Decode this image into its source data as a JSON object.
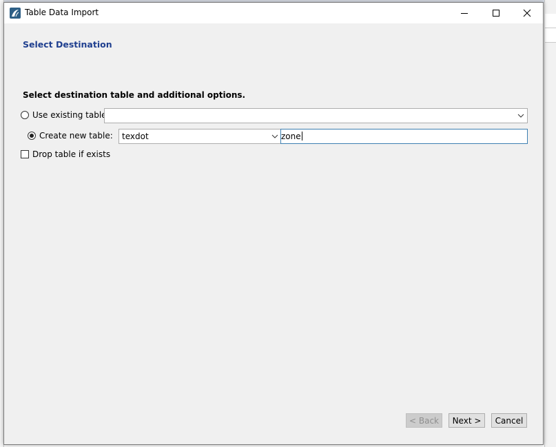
{
  "window": {
    "title": "Table Data Import",
    "minimize_icon": "minimize-icon",
    "maximize_icon": "maximize-icon",
    "close_icon": "close-icon"
  },
  "page": {
    "section_title": "Select Destination",
    "instruction": "Select destination table and additional options."
  },
  "options": {
    "use_existing_label": "Use existing table:",
    "use_existing_value": "",
    "use_existing_selected": false,
    "create_new_label": "Create new table:",
    "create_new_selected": true,
    "schema_value": "texdot",
    "table_name_value": "zone",
    "drop_table_label": "Drop table if exists",
    "drop_table_checked": false
  },
  "buttons": {
    "back_label": "< Back",
    "next_label": "Next >",
    "cancel_label": "Cancel"
  },
  "colors": {
    "section_title": "#1f3f8f",
    "focus_border": "#3c7fb1"
  }
}
